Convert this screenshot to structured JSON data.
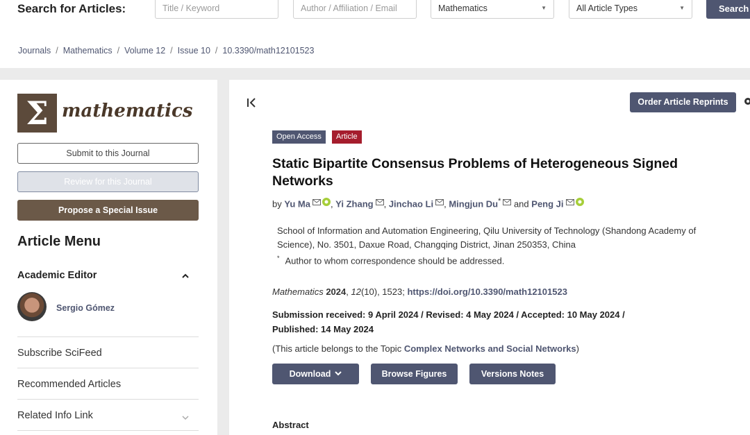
{
  "search": {
    "label": "Search for Articles:",
    "title_placeholder": "Title / Keyword",
    "author_placeholder": "Author / Affiliation / Email",
    "journal_selected": "Mathematics",
    "type_selected": "All Article Types",
    "button": "Search"
  },
  "breadcrumb": [
    "Journals",
    "Mathematics",
    "Volume 12",
    "Issue 10",
    "10.3390/math12101523"
  ],
  "sidebar": {
    "logo_glyph": "Σ",
    "logo_text": "mathematics",
    "submit": "Submit to this Journal",
    "review": "Review for this Journal",
    "propose": "Propose a Special Issue",
    "menu_title": "Article Menu",
    "academic_editor": "Academic Editor",
    "editor_name": "Sergio Gómez",
    "links": [
      "Subscribe SciFeed",
      "Recommended Articles",
      "Related Info Link"
    ]
  },
  "article": {
    "reprints": "Order Article Reprints",
    "badge_open": "Open Access",
    "badge_type": "Article",
    "title": "Static Bipartite Consensus Problems of Heterogeneous Signed Networks",
    "by": "by",
    "authors": [
      "Yu Ma",
      "Yi Zhang",
      "Jinchao Li",
      "Mingjun Du",
      "Peng Ji"
    ],
    "and": "and",
    "star": "*",
    "affiliation": "School of Information and Automation Engineering, Qilu University of Technology (Shandong Academy of Science), No. 3501, Daxue Road, Changqing District, Jinan 250353, China",
    "corresp_mark": "*",
    "corresp": "Author to whom correspondence should be addressed.",
    "cite_journal": "Mathematics",
    "cite_year": "2024",
    "cite_volume": "12",
    "cite_rest": "(10), 1523;",
    "doi": "https://doi.org/10.3390/math12101523",
    "dates_line1": "Submission received: 9 April 2024 / Revised: 4 May 2024 / Accepted: 10 May 2024 /",
    "dates_line2": "Published: 14 May 2024",
    "topic_prefix": "(This article belongs to the Topic ",
    "topic_link": "Complex Networks and Social Networks",
    "topic_suffix": ")",
    "download": "Download",
    "figures": "Browse Figures",
    "versions": "Versions Notes",
    "abstract": "Abstract"
  }
}
